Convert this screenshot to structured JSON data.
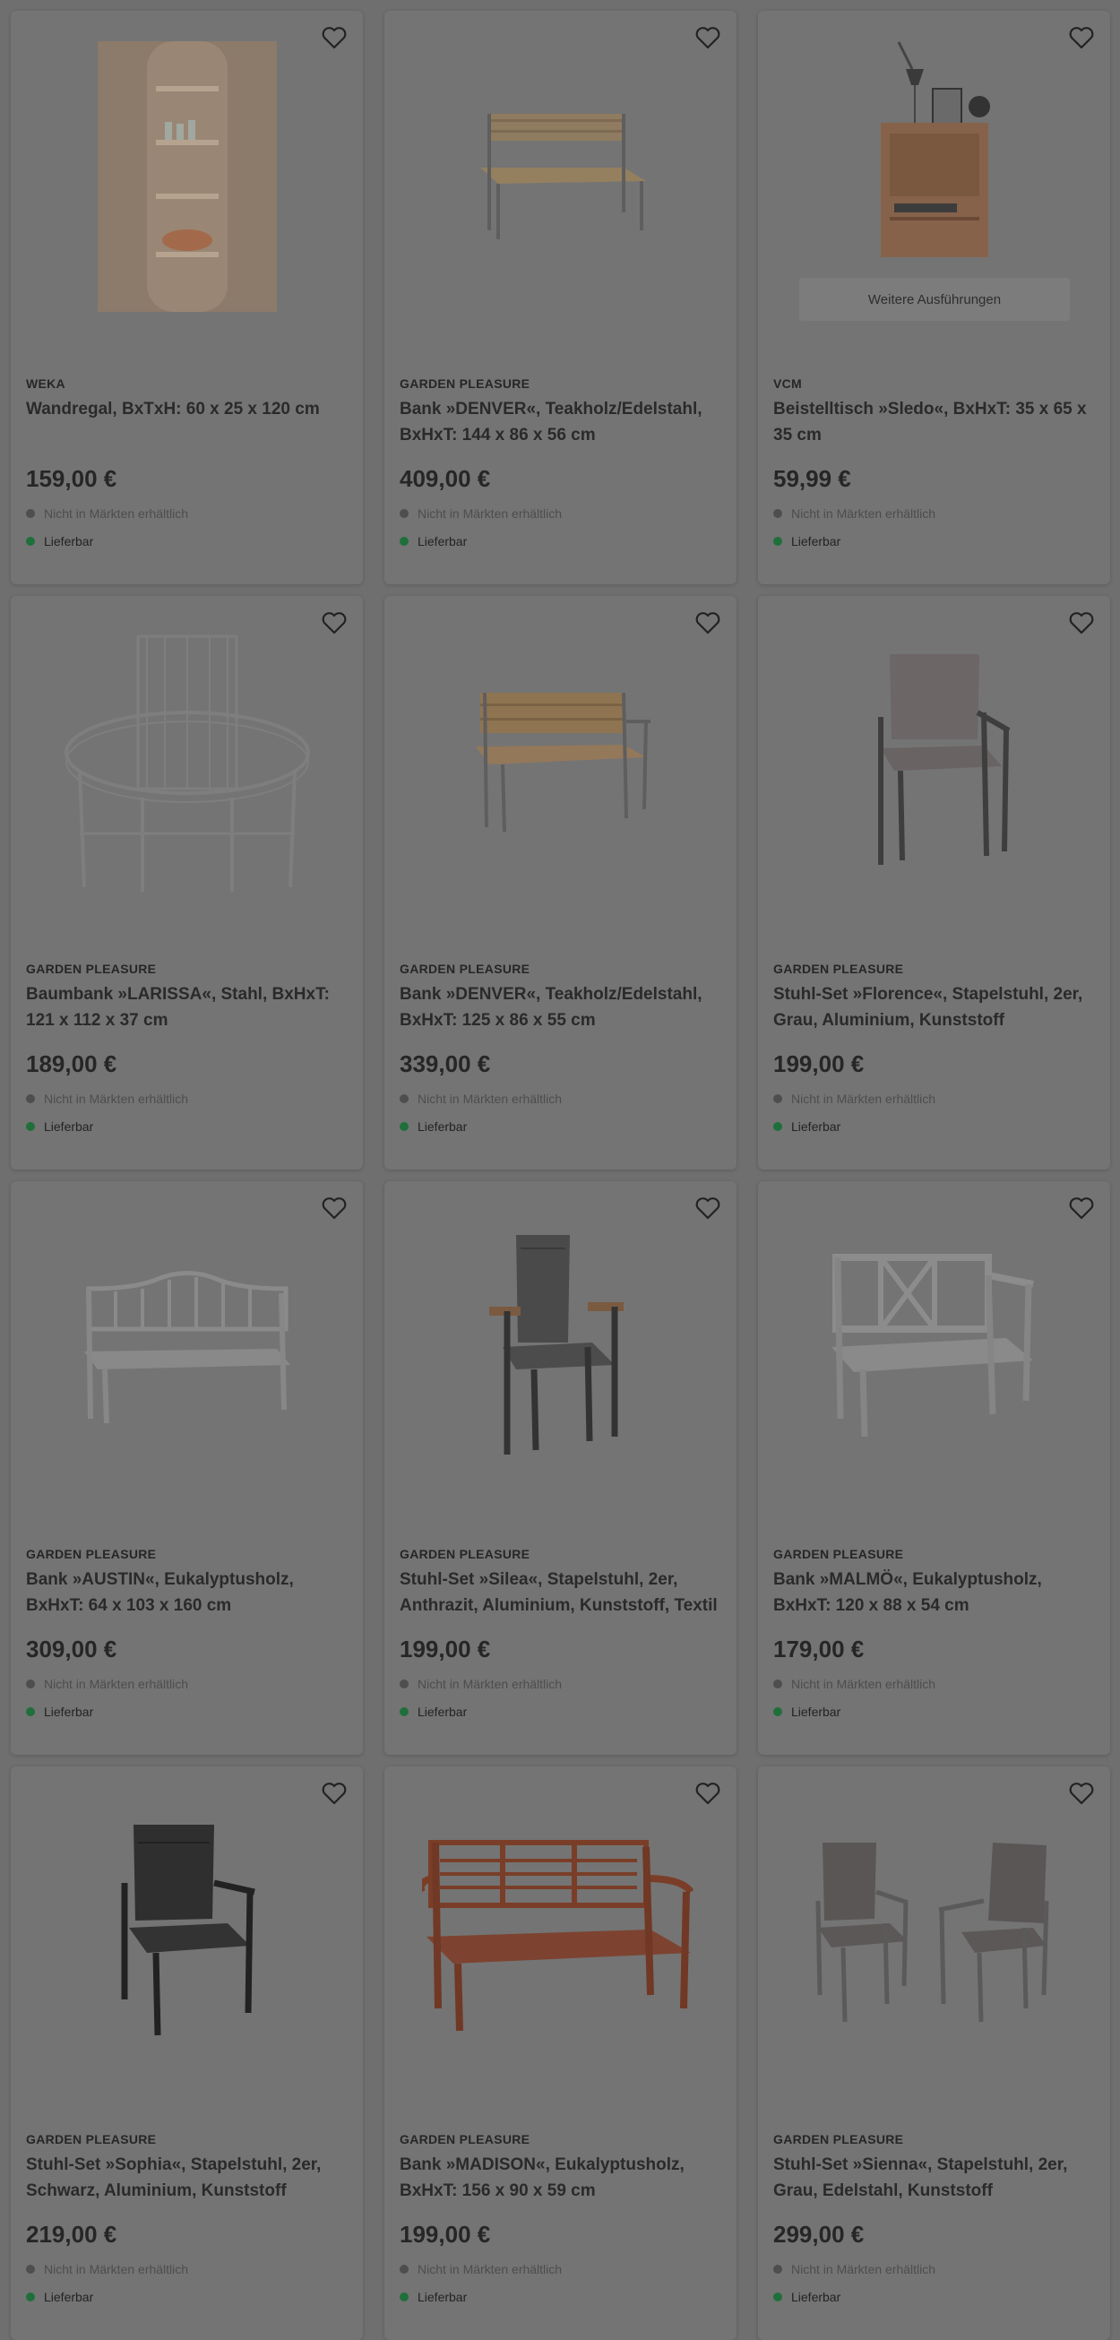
{
  "availability": {
    "store": "Nicht in Märkten erhältlich",
    "delivery": "Lieferbar"
  },
  "colors": {
    "background": "#6f6f6f",
    "card": "#747474",
    "delivery_dot": "#1f6f3a",
    "store_dot": "#4e4e4e"
  },
  "products": [
    {
      "brand": "WEKA",
      "title": "Wandregal, BxTxH: 60 x 25 x 120 cm",
      "price": "159,00 €",
      "icon": "wall-shelf-image"
    },
    {
      "brand": "GARDEN PLEASURE",
      "title": "Bank »DENVER«, Teakholz/Edelstahl, BxHxT: 144 x 86 x 56 cm",
      "price": "409,00 €",
      "icon": "bench-image"
    },
    {
      "brand": "VCM",
      "title": "Beistelltisch »Sledo«, BxHxT: 35 x 65 x 35 cm",
      "price": "59,99 €",
      "icon": "side-table-image",
      "variants_label": "Weitere Ausführungen"
    },
    {
      "brand": "GARDEN PLEASURE",
      "title": "Baumbank »LARISSA«, Stahl, BxHxT: 121 x 112 x 37 cm",
      "price": "189,00 €",
      "icon": "tree-bench-image"
    },
    {
      "brand": "GARDEN PLEASURE",
      "title": "Bank »DENVER«, Teakholz/Edelstahl, BxHxT: 125 x 86 x 55 cm",
      "price": "339,00 €",
      "icon": "bench-image"
    },
    {
      "brand": "GARDEN PLEASURE",
      "title": "Stuhl-Set »Florence«, Stapelstuhl, 2er, Grau, Aluminium, Kunststoff",
      "price": "199,00 €",
      "icon": "chair-image"
    },
    {
      "brand": "GARDEN PLEASURE",
      "title": "Bank »AUSTIN«, Eukalyptusholz, BxHxT: 64 x 103 x 160 cm",
      "price": "309,00 €",
      "icon": "bench-image"
    },
    {
      "brand": "GARDEN PLEASURE",
      "title": "Stuhl-Set »Silea«, Stapelstuhl, 2er, Anthrazit, Aluminium, Kunststoff, Textil",
      "price": "199,00 €",
      "icon": "chair-image"
    },
    {
      "brand": "GARDEN PLEASURE",
      "title": "Bank »MALMÖ«, Eukalyptusholz, BxHxT: 120 x 88 x 54 cm",
      "price": "179,00 €",
      "icon": "bench-image"
    },
    {
      "brand": "GARDEN PLEASURE",
      "title": "Stuhl-Set »Sophia«, Stapelstuhl, 2er, Schwarz, Aluminium, Kunststoff",
      "price": "219,00 €",
      "icon": "chair-image"
    },
    {
      "brand": "GARDEN PLEASURE",
      "title": "Bank »MADISON«, Eukalyptusholz, BxHxT: 156 x 90 x 59 cm",
      "price": "199,00 €",
      "icon": "bench-image"
    },
    {
      "brand": "GARDEN PLEASURE",
      "title": "Stuhl-Set »Sienna«, Stapelstuhl, 2er, Grau, Edelstahl, Kunststoff",
      "price": "299,00 €",
      "icon": "chairs-pair-image"
    }
  ]
}
